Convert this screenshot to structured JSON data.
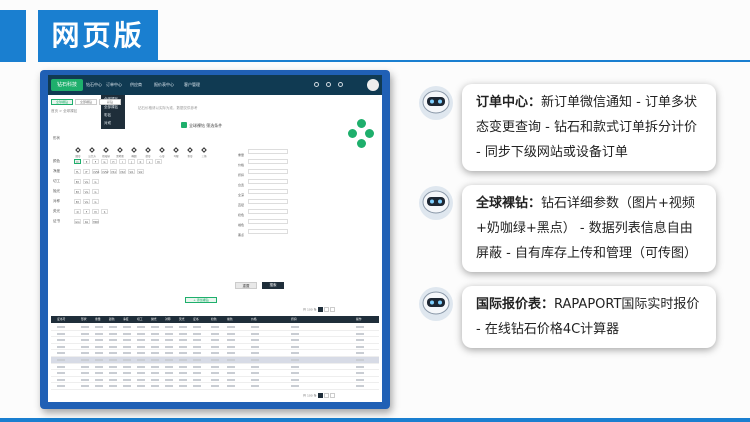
{
  "page_title": "网页版",
  "app": {
    "logo_text": "钻石科技",
    "nav": [
      "钻石中心",
      "订单中心",
      "供应商",
      "报价表中心",
      "客户管理"
    ],
    "dropdown": [
      "全球裸钻",
      "全部裸钻",
      "彩钻",
      "对戒"
    ],
    "tabs": [
      "全球裸钻",
      "全部裸钻",
      "彩钻"
    ],
    "notice": "钻石价格请以实际为准，数据仅供参考",
    "breadcrumb": "首页 > 全球裸钻",
    "section_title": "全球裸钻 筛选条件",
    "filter_labels": [
      "形状",
      "颜色",
      "净度",
      "切工",
      "抛光",
      "对称",
      "荧光",
      "证书"
    ],
    "shapes": [
      "圆形",
      "公主方",
      "祖母绿",
      "雷地恩",
      "椭圆",
      "梨形",
      "心形",
      "马眼",
      "垫形",
      "三角"
    ],
    "right_labels": [
      "重量",
      "价格",
      "折扣",
      "台宽",
      "全深",
      "直径",
      "奶色",
      "咖色",
      "黑点"
    ],
    "btn_reset": "重置",
    "btn_search": "搜索",
    "btn_add": "+ 添加裸钻",
    "table_headers": [
      "证书号",
      "形状",
      "重量",
      "颜色",
      "净度",
      "切工",
      "抛光",
      "对称",
      "荧光",
      "证书",
      "奶色",
      "咖色",
      "价格",
      "折扣",
      "操作"
    ],
    "pager_text": "共 100 条"
  },
  "cards": [
    {
      "key": "订单中心：",
      "text": "新订单微信通知 - 订单多状态变更查询 - 钻石和款式订单拆分计价 - 同步下级网站或设备订单"
    },
    {
      "key": "全球裸钻：",
      "text": "钻石详细参数（图片+视频+奶咖绿+黑点） - 数据列表信息自由屏蔽 - 自有库存上传和管理（可传图）"
    },
    {
      "key": "国际报价表：",
      "text": "RAPAPORT国际实时报价 - 在线钻石价格4C计算器"
    }
  ],
  "colors": {
    "accent": "#1a7fd0",
    "brand_green": "#1eaf6c",
    "dark": "#1f2e3a"
  }
}
